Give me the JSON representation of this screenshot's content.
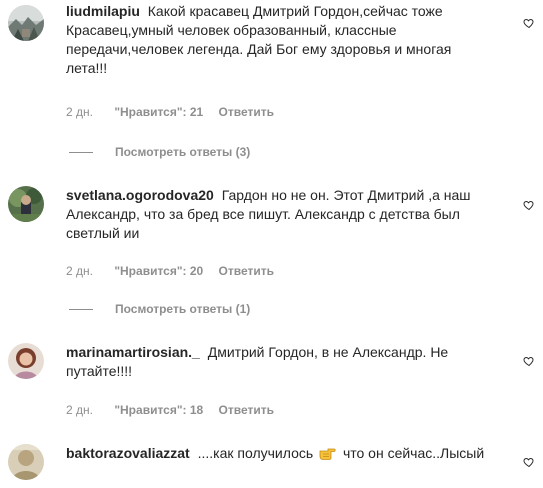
{
  "comments": [
    {
      "username": "liudmilapiu",
      "text": "Какой красавец Дмитрий Гордон,сейчас тоже Красавец,умный человек образованный, классные передачи,человек легенда. Дай Бог ему здоровья и многая лета!!!",
      "time": "2 дн.",
      "likes": "\"Нравится\": 21",
      "reply": "Ответить",
      "view_replies": "Посмотреть ответы (3)",
      "avatar_icon": "user-avatar-winter-scene"
    },
    {
      "username": "svetlana.ogorodova20",
      "text": "Гардон но не он. Этот Дмитрий ,а наш Александр, что за бред все пишут. Александр с детства был светлый ии",
      "time": "2 дн.",
      "likes": "\"Нравится\": 20",
      "reply": "Ответить",
      "view_replies": "Посмотреть ответы (1)",
      "avatar_icon": "user-avatar-garden"
    },
    {
      "username": "marinamartirosian._",
      "text": "Дмитрий Гордон, в не Александр. Не путайте!!!!",
      "time": "2 дн.",
      "likes": "\"Нравится\": 18",
      "reply": "Ответить",
      "avatar_icon": "user-avatar-portrait"
    },
    {
      "username": "baktorazovaliazzat",
      "text_before_emoji": "....как получилось",
      "emoji": "pointing-hand-emoji",
      "text_after_emoji": "что он сейчас..Лысый",
      "avatar_icon": "user-avatar-sepia"
    }
  ],
  "colors": {
    "text": "#262626",
    "secondary": "#8e8e8e",
    "background": "#ffffff"
  }
}
